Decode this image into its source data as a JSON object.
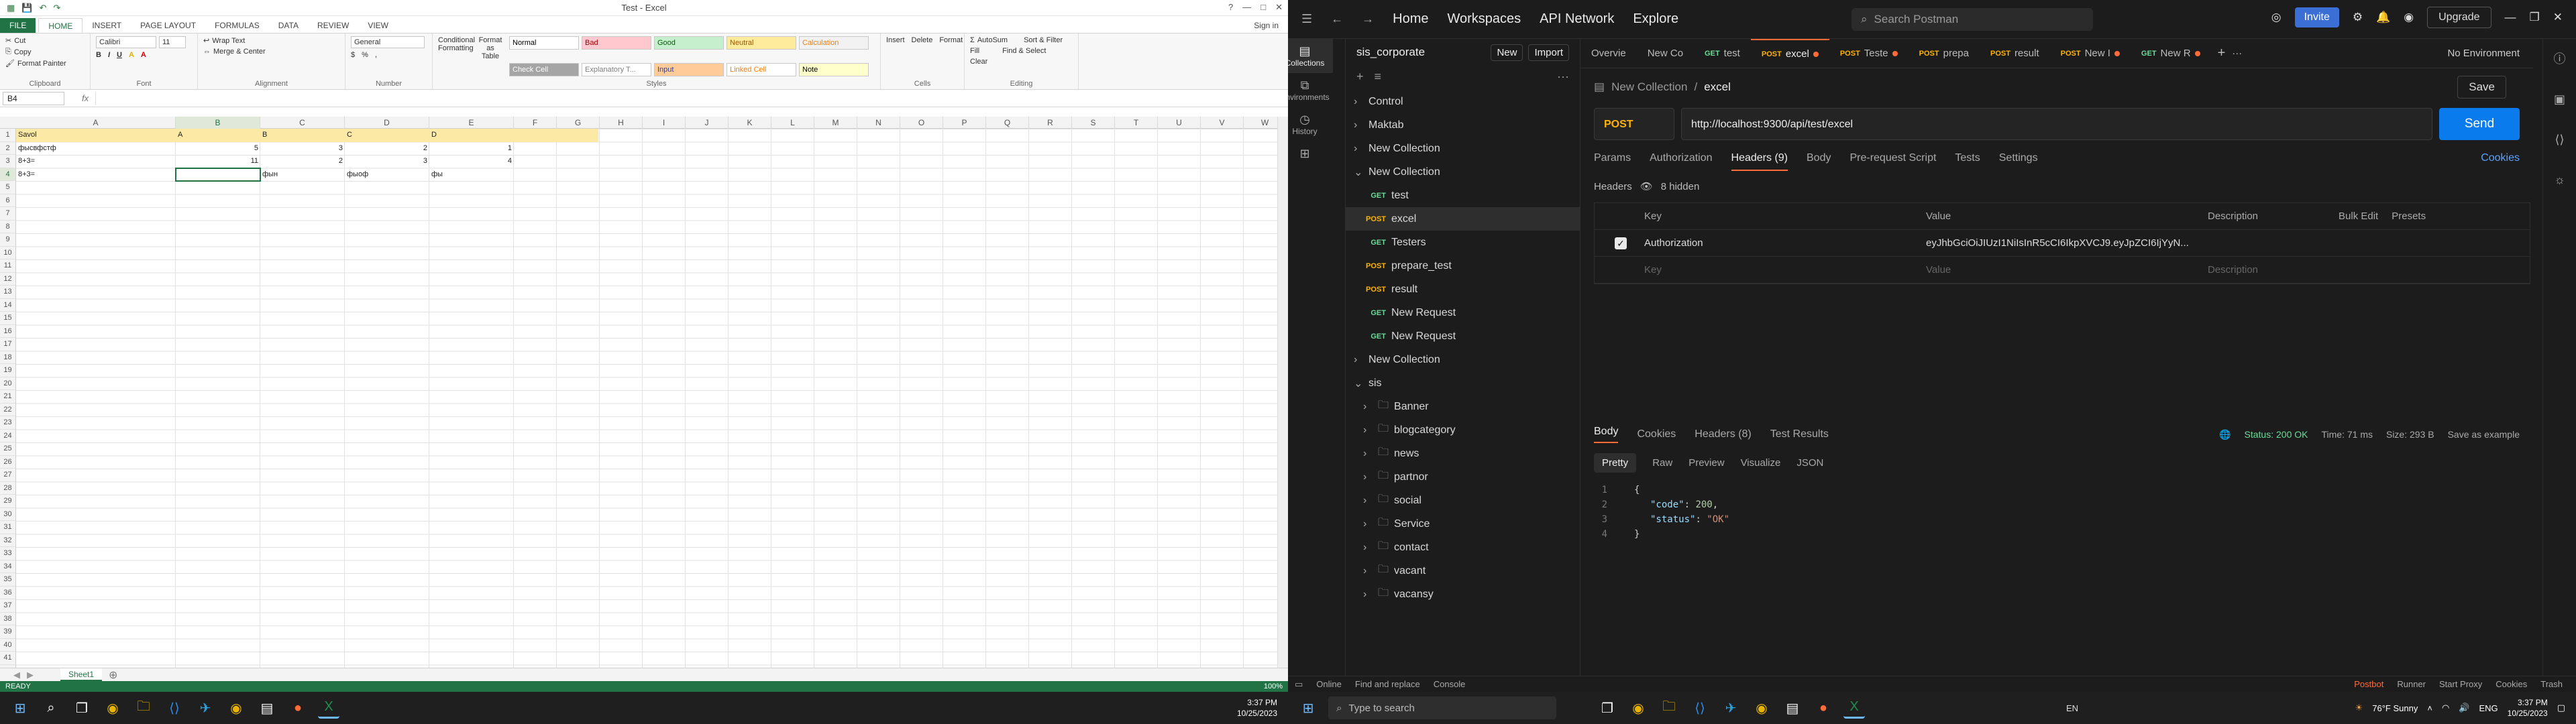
{
  "excel": {
    "window_title": "Test - Excel",
    "ribbon_tabs": [
      "FILE",
      "HOME",
      "INSERT",
      "PAGE LAYOUT",
      "FORMULAS",
      "DATA",
      "REVIEW",
      "VIEW"
    ],
    "active_tab": "HOME",
    "sign_in": "Sign in",
    "clipboard": {
      "cut": "Cut",
      "copy": "Copy",
      "format_painter": "Format Painter",
      "label": "Clipboard",
      "paste": "Paste"
    },
    "font": {
      "name": "Calibri",
      "size": "11",
      "label": "Font"
    },
    "alignment": {
      "wrap": "Wrap Text",
      "merge": "Merge & Center",
      "label": "Alignment"
    },
    "number": {
      "format": "General",
      "label": "Number"
    },
    "styles": {
      "label": "Styles",
      "conditional": "Conditional Formatting",
      "format_table": "Format as Table",
      "items": [
        {
          "name": "Normal",
          "bg": "#ffffff",
          "fg": "#000000"
        },
        {
          "name": "Bad",
          "bg": "#ffc7ce",
          "fg": "#9c0006"
        },
        {
          "name": "Good",
          "bg": "#c6efce",
          "fg": "#006100"
        },
        {
          "name": "Neutral",
          "bg": "#ffeb9c",
          "fg": "#9c5700"
        },
        {
          "name": "Calculation",
          "bg": "#f2f2f2",
          "fg": "#fa7d00"
        },
        {
          "name": "Check Cell",
          "bg": "#a5a5a5",
          "fg": "#ffffff"
        },
        {
          "name": "Explanatory T...",
          "bg": "#ffffff",
          "fg": "#7f7f7f"
        },
        {
          "name": "Input",
          "bg": "#ffcc99",
          "fg": "#3f3f76"
        },
        {
          "name": "Linked Cell",
          "bg": "#ffffff",
          "fg": "#fa7d00"
        },
        {
          "name": "Note",
          "bg": "#ffffcc",
          "fg": "#000000"
        }
      ]
    },
    "cells_group": {
      "insert": "Insert",
      "delete": "Delete",
      "format": "Format",
      "label": "Cells"
    },
    "editing": {
      "autosum": "AutoSum",
      "fill": "Fill",
      "clear": "Clear",
      "sort": "Sort & Filter",
      "find": "Find & Select",
      "label": "Editing"
    },
    "name_box": "B4",
    "fx": "fx",
    "columns": [
      "A",
      "B",
      "C",
      "D",
      "E",
      "F",
      "G",
      "H",
      "I",
      "J",
      "K",
      "L",
      "M",
      "N",
      "O",
      "P",
      "Q",
      "R",
      "S",
      "T",
      "U",
      "V",
      "W"
    ],
    "rows": [
      "1",
      "2",
      "3",
      "4",
      "5",
      "6",
      "7",
      "8",
      "9",
      "10",
      "11",
      "12",
      "13",
      "14",
      "15",
      "16",
      "17",
      "18",
      "19",
      "20",
      "21",
      "22",
      "23",
      "24",
      "25",
      "26",
      "27",
      "28",
      "29",
      "30",
      "31",
      "32",
      "33",
      "34",
      "35",
      "36",
      "37",
      "38",
      "39",
      "40",
      "41",
      "42"
    ],
    "data": {
      "r1": [
        "Savol",
        "A",
        "B",
        "C",
        "D"
      ],
      "r2": [
        "фысвфстф",
        "5",
        "3",
        "2",
        "1"
      ],
      "r3": [
        "8+3=",
        "11",
        "2",
        "3",
        "4"
      ],
      "r4": [
        "8+3=",
        "",
        "фын",
        "фыоф",
        "фы"
      ]
    },
    "sheet_tab": "Sheet1",
    "status_ready": "READY",
    "zoom": "100%"
  },
  "taskbar_left": {
    "time": "3:37 PM",
    "date": "10/25/2023"
  },
  "postman": {
    "nav": {
      "home": "Home",
      "workspaces": "Workspaces",
      "api_network": "API Network",
      "explore": "Explore"
    },
    "search_placeholder": "Search Postman",
    "invite": "Invite",
    "upgrade": "Upgrade",
    "workspace_name": "sis_corporate",
    "new_btn": "New",
    "import_btn": "Import",
    "side_icons": [
      "Collections",
      "Environments",
      "History"
    ],
    "tree": [
      {
        "kind": "folder",
        "label": "Control",
        "depth": 0,
        "chev": ">"
      },
      {
        "kind": "folder",
        "label": "Maktab",
        "depth": 0,
        "chev": ">"
      },
      {
        "kind": "folder",
        "label": "New Collection",
        "depth": 0,
        "chev": ">"
      },
      {
        "kind": "folder",
        "label": "New Collection",
        "depth": 0,
        "chev": "v"
      },
      {
        "kind": "req",
        "method": "GET",
        "label": "test",
        "depth": 1
      },
      {
        "kind": "req",
        "method": "POST",
        "label": "excel",
        "depth": 1,
        "selected": true
      },
      {
        "kind": "req",
        "method": "GET",
        "label": "Testers",
        "depth": 1
      },
      {
        "kind": "req",
        "method": "POST",
        "label": "prepare_test",
        "depth": 1
      },
      {
        "kind": "req",
        "method": "POST",
        "label": "result",
        "depth": 1
      },
      {
        "kind": "req",
        "method": "GET",
        "label": "New Request",
        "depth": 1
      },
      {
        "kind": "req",
        "method": "GET",
        "label": "New Request",
        "depth": 1
      },
      {
        "kind": "folder",
        "label": "New Collection",
        "depth": 0,
        "chev": ">"
      },
      {
        "kind": "folder",
        "label": "sis",
        "depth": 0,
        "chev": "v"
      },
      {
        "kind": "sub",
        "label": "Banner",
        "depth": 1
      },
      {
        "kind": "sub",
        "label": "blogcategory",
        "depth": 1
      },
      {
        "kind": "sub",
        "label": "news",
        "depth": 1
      },
      {
        "kind": "sub",
        "label": "partnor",
        "depth": 1
      },
      {
        "kind": "sub",
        "label": "social",
        "depth": 1
      },
      {
        "kind": "sub",
        "label": "Service",
        "depth": 1
      },
      {
        "kind": "sub",
        "label": "contact",
        "depth": 1
      },
      {
        "kind": "sub",
        "label": "vacant",
        "depth": 1
      },
      {
        "kind": "sub",
        "label": "vacansy",
        "depth": 1
      }
    ],
    "tabs": [
      {
        "method": "",
        "label": "Overvie"
      },
      {
        "method": "",
        "label": "New Co"
      },
      {
        "method": "GET",
        "label": "test"
      },
      {
        "method": "POST",
        "label": "excel",
        "active": true,
        "dot": true
      },
      {
        "method": "POST",
        "label": "Teste",
        "dot": true
      },
      {
        "method": "POST",
        "label": "prepa"
      },
      {
        "method": "POST",
        "label": "result"
      },
      {
        "method": "POST",
        "label": "New I",
        "dot": true
      },
      {
        "method": "GET",
        "label": "New R",
        "dot": true
      }
    ],
    "environment": "No Environment",
    "breadcrumb": {
      "collection": "New Collection",
      "request": "excel"
    },
    "save": "Save",
    "method": "POST",
    "url": "http://localhost:9300/api/test/excel",
    "send": "Send",
    "req_tabs": [
      "Params",
      "Authorization",
      "Headers (9)",
      "Body",
      "Pre-request Script",
      "Tests",
      "Settings"
    ],
    "active_req_tab": "Headers (9)",
    "cookies": "Cookies",
    "headers_label": "Headers",
    "hidden": "8 hidden",
    "table_head": {
      "key": "Key",
      "value": "Value",
      "desc": "Description",
      "bulk": "Bulk Edit",
      "presets": "Presets"
    },
    "header_row": {
      "key": "Authorization",
      "value": "eyJhbGciOiJIUzI1NiIsInR5cCI6IkpXVCJ9.eyJpZCI6IjYyN..."
    },
    "placeholder_row": {
      "key": "Key",
      "value": "Value",
      "desc": "Description"
    },
    "resp_tabs": [
      "Body",
      "Cookies",
      "Headers (8)",
      "Test Results"
    ],
    "status": "Status: 200 OK",
    "time": "Time: 71 ms",
    "size": "Size: 293 B",
    "save_example": "Save as example",
    "fmt": [
      "Pretty",
      "Raw",
      "Preview",
      "Visualize",
      "JSON"
    ],
    "code": [
      {
        "n": "1",
        "t": "{"
      },
      {
        "n": "2",
        "k": "\"code\"",
        "v": "200",
        "vtype": "num"
      },
      {
        "n": "3",
        "k": "\"status\"",
        "v": "\"OK\"",
        "vtype": "str"
      },
      {
        "n": "4",
        "t": "}"
      }
    ],
    "statusbar": {
      "online": "Online",
      "find": "Find and replace",
      "console": "Console",
      "postbot": "Postbot",
      "runner": "Runner",
      "proxy": "Start Proxy",
      "cookies": "Cookies",
      "trash": "Trash"
    }
  },
  "taskbar_right": {
    "search": "Type to search",
    "lang": "EN",
    "weather": "76°F Sunny",
    "eng": "ENG",
    "time": "3:37 PM",
    "date": "10/25/2023"
  }
}
